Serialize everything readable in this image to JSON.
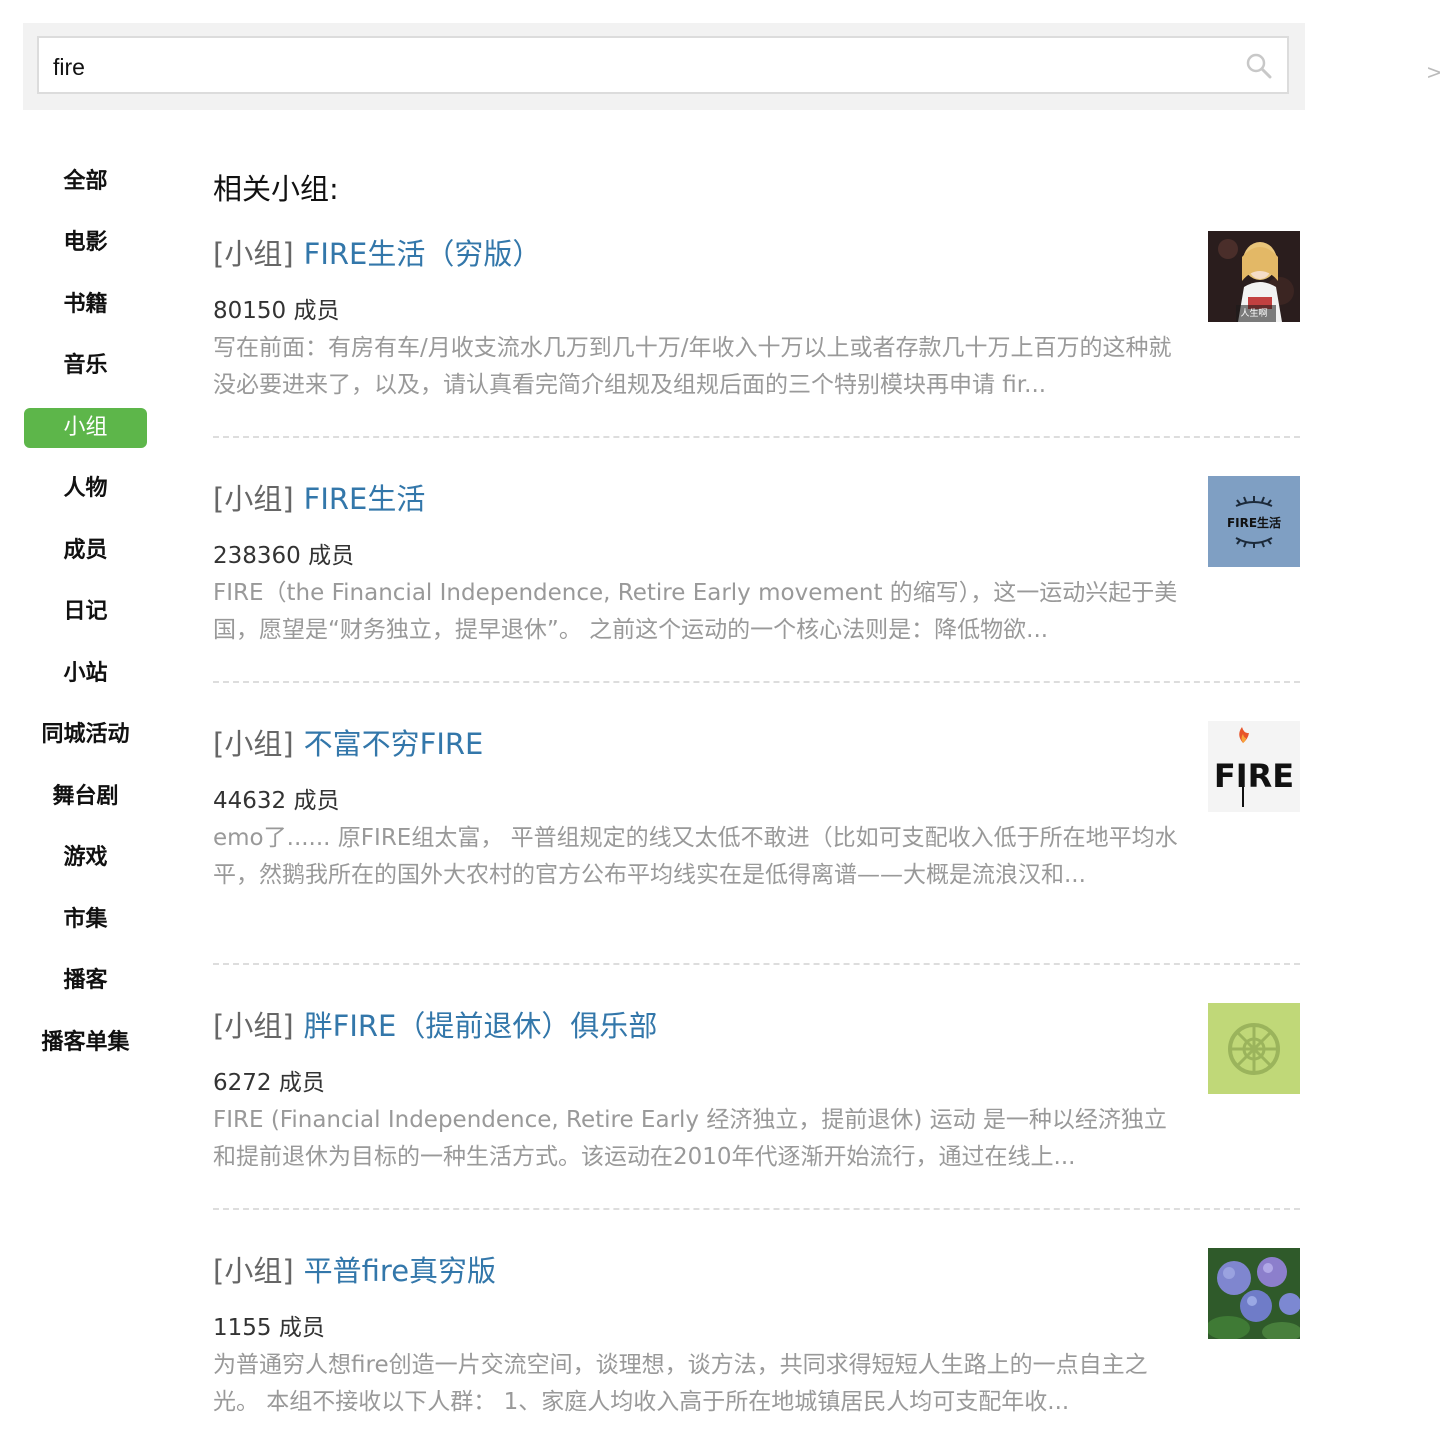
{
  "search": {
    "value": "fire"
  },
  "nav_arrow": ">",
  "categories": [
    {
      "label": "全部",
      "active": false
    },
    {
      "label": "电影",
      "active": false
    },
    {
      "label": "书籍",
      "active": false
    },
    {
      "label": "音乐",
      "active": false
    },
    {
      "label": "小组",
      "active": true
    },
    {
      "label": "人物",
      "active": false
    },
    {
      "label": "成员",
      "active": false
    },
    {
      "label": "日记",
      "active": false
    },
    {
      "label": "小站",
      "active": false
    },
    {
      "label": "同城活动",
      "active": false
    },
    {
      "label": "舞台剧",
      "active": false
    },
    {
      "label": "游戏",
      "active": false
    },
    {
      "label": "市集",
      "active": false
    },
    {
      "label": "播客",
      "active": false
    },
    {
      "label": "播客单集",
      "active": false
    }
  ],
  "section_title": "相关小组:",
  "results": [
    {
      "type": "[小组]",
      "title": "FIRE生活（穷版）",
      "members": "80150 成员",
      "description": "写在前面：有房有车/月收支流水几万到几十万/年收入十万以上或者存款几十万上百万的这种就没必要进来了，以及，请认真看完简介组规及组规后面的三个特别模块再申请 fir...",
      "thumb_icon": "anime-girl-avatar",
      "thumb_text": "人生啊"
    },
    {
      "type": "[小组]",
      "title": "FIRE生活",
      "members": "238360 成员",
      "description": "FIRE（the Financial Independence, Retire Early movement 的缩写），这一运动兴起于美国，愿望是“财务独立，提早退休”。 之前这个运动的一个核心法则是：降低物欲...",
      "thumb_icon": "laurel-logo",
      "thumb_text": "FIRE生活"
    },
    {
      "type": "[小组]",
      "title": "不富不穷FIRE",
      "members": "44632 成员",
      "description": "emo了...... 原FIRE组太富， 平普组规定的线又太低不敢进（比如可支配收入低于所在地平均水平，然鹅我所在的国外大农村的官方公布平均线实在是低得离谱——大概是流浪汉和...",
      "thumb_icon": "fire-logo",
      "thumb_text": "FIRE"
    },
    {
      "type": "[小组]",
      "title": "胖FIRE（提前退休）俱乐部",
      "members": "6272 成员",
      "description": "FIRE (Financial Independence, Retire Early 经济独立，提前退休) 运动 是一种以经济独立和提前退休为目标的一种生活方式。该运动在2010年代逐渐开始流行，通过在线上...",
      "thumb_icon": "green-emblem",
      "thumb_text": ""
    },
    {
      "type": "[小组]",
      "title": "平普fire真穷版",
      "members": "1155 成员",
      "description": "为普通穷人想fire创造一片交流空间，谈理想，谈方法，共同求得短短人生路上的一点自主之光。 本组不接收以下人群： 1、家庭人均收入高于所在地城镇居民人均可支配年收...",
      "thumb_icon": "hydrangea-photo",
      "thumb_text": ""
    }
  ],
  "colors": {
    "accent_green": "#5db64a",
    "link_blue": "#3377aa",
    "desc_gray": "#999999"
  }
}
